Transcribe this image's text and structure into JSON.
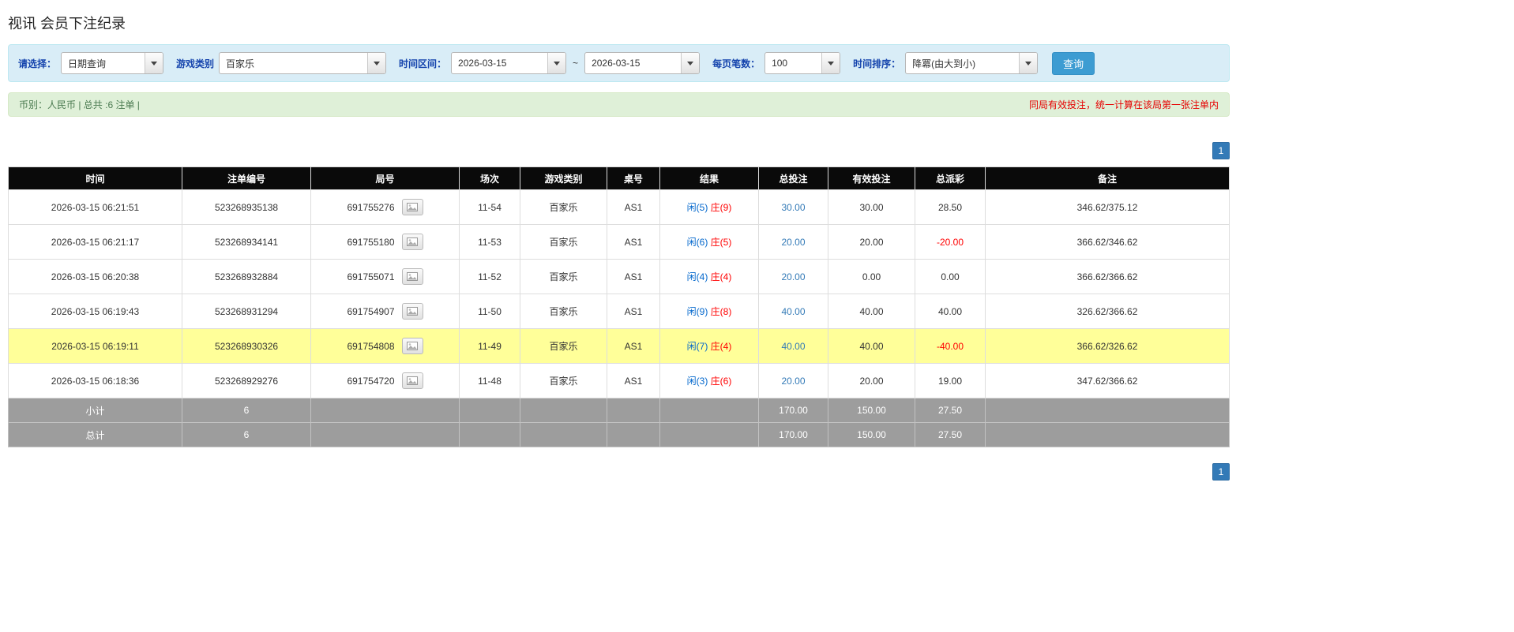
{
  "page": {
    "title": "视讯 会员下注纪录"
  },
  "filters": {
    "select_label": "请选择：",
    "select_value": "日期查询",
    "game_type_label": "游戏类别",
    "game_type_value": "百家乐",
    "time_range_label": "时间区间：",
    "date_from": "2026-03-15",
    "range_separator": "~",
    "date_to": "2026-03-15",
    "page_size_label": "每页笔数：",
    "page_size_value": "100",
    "sort_label": "时间排序：",
    "sort_value": "降冪(由大到小)",
    "query_button": "查询"
  },
  "info_bar": {
    "summary": "币别：人民币 | 总共 :6 注单 |",
    "notice": "同局有效投注，统一计算在该局第一张注单内"
  },
  "pagination": {
    "page": "1"
  },
  "table": {
    "headers": {
      "time": "时间",
      "bet_id": "注单编号",
      "round_id": "局号",
      "session": "场次",
      "game_type": "游戏类别",
      "table_no": "桌号",
      "result": "结果",
      "total_bet": "总投注",
      "valid_bet": "有效投注",
      "payout": "总派彩",
      "note": "备注"
    },
    "rows": [
      {
        "time": "2026-03-15 06:21:51",
        "bet_id": "523268935138",
        "round_id": "691755276",
        "session": "11-54",
        "game_type": "百家乐",
        "table_no": "AS1",
        "result_player": "闲(5)",
        "result_banker": "庄(9)",
        "total_bet": "30.00",
        "valid_bet": "30.00",
        "payout": "28.50",
        "note": "346.62/375.12"
      },
      {
        "time": "2026-03-15 06:21:17",
        "bet_id": "523268934141",
        "round_id": "691755180",
        "session": "11-53",
        "game_type": "百家乐",
        "table_no": "AS1",
        "result_player": "闲(6)",
        "result_banker": "庄(5)",
        "total_bet": "20.00",
        "valid_bet": "20.00",
        "payout": "-20.00",
        "note": "366.62/346.62"
      },
      {
        "time": "2026-03-15 06:20:38",
        "bet_id": "523268932884",
        "round_id": "691755071",
        "session": "11-52",
        "game_type": "百家乐",
        "table_no": "AS1",
        "result_player": "闲(4)",
        "result_banker": "庄(4)",
        "total_bet": "20.00",
        "valid_bet": "0.00",
        "payout": "0.00",
        "note": "366.62/366.62"
      },
      {
        "time": "2026-03-15 06:19:43",
        "bet_id": "523268931294",
        "round_id": "691754907",
        "session": "11-50",
        "game_type": "百家乐",
        "table_no": "AS1",
        "result_player": "闲(9)",
        "result_banker": "庄(8)",
        "total_bet": "40.00",
        "valid_bet": "40.00",
        "payout": "40.00",
        "note": "326.62/366.62"
      },
      {
        "time": "2026-03-15 06:19:11",
        "bet_id": "523268930326",
        "round_id": "691754808",
        "session": "11-49",
        "game_type": "百家乐",
        "table_no": "AS1",
        "result_player": "闲(7)",
        "result_banker": "庄(4)",
        "total_bet": "40.00",
        "valid_bet": "40.00",
        "payout": "-40.00",
        "note": "366.62/326.62"
      },
      {
        "time": "2026-03-15 06:18:36",
        "bet_id": "523268929276",
        "round_id": "691754720",
        "session": "11-48",
        "game_type": "百家乐",
        "table_no": "AS1",
        "result_player": "闲(3)",
        "result_banker": "庄(6)",
        "total_bet": "20.00",
        "valid_bet": "20.00",
        "payout": "19.00",
        "note": "347.62/366.62"
      }
    ],
    "subtotal": {
      "label": "小计",
      "count": "6",
      "total_bet": "170.00",
      "valid_bet": "150.00",
      "payout": "27.50"
    },
    "total": {
      "label": "总计",
      "count": "6",
      "total_bet": "170.00",
      "valid_bet": "150.00",
      "payout": "27.50"
    }
  }
}
